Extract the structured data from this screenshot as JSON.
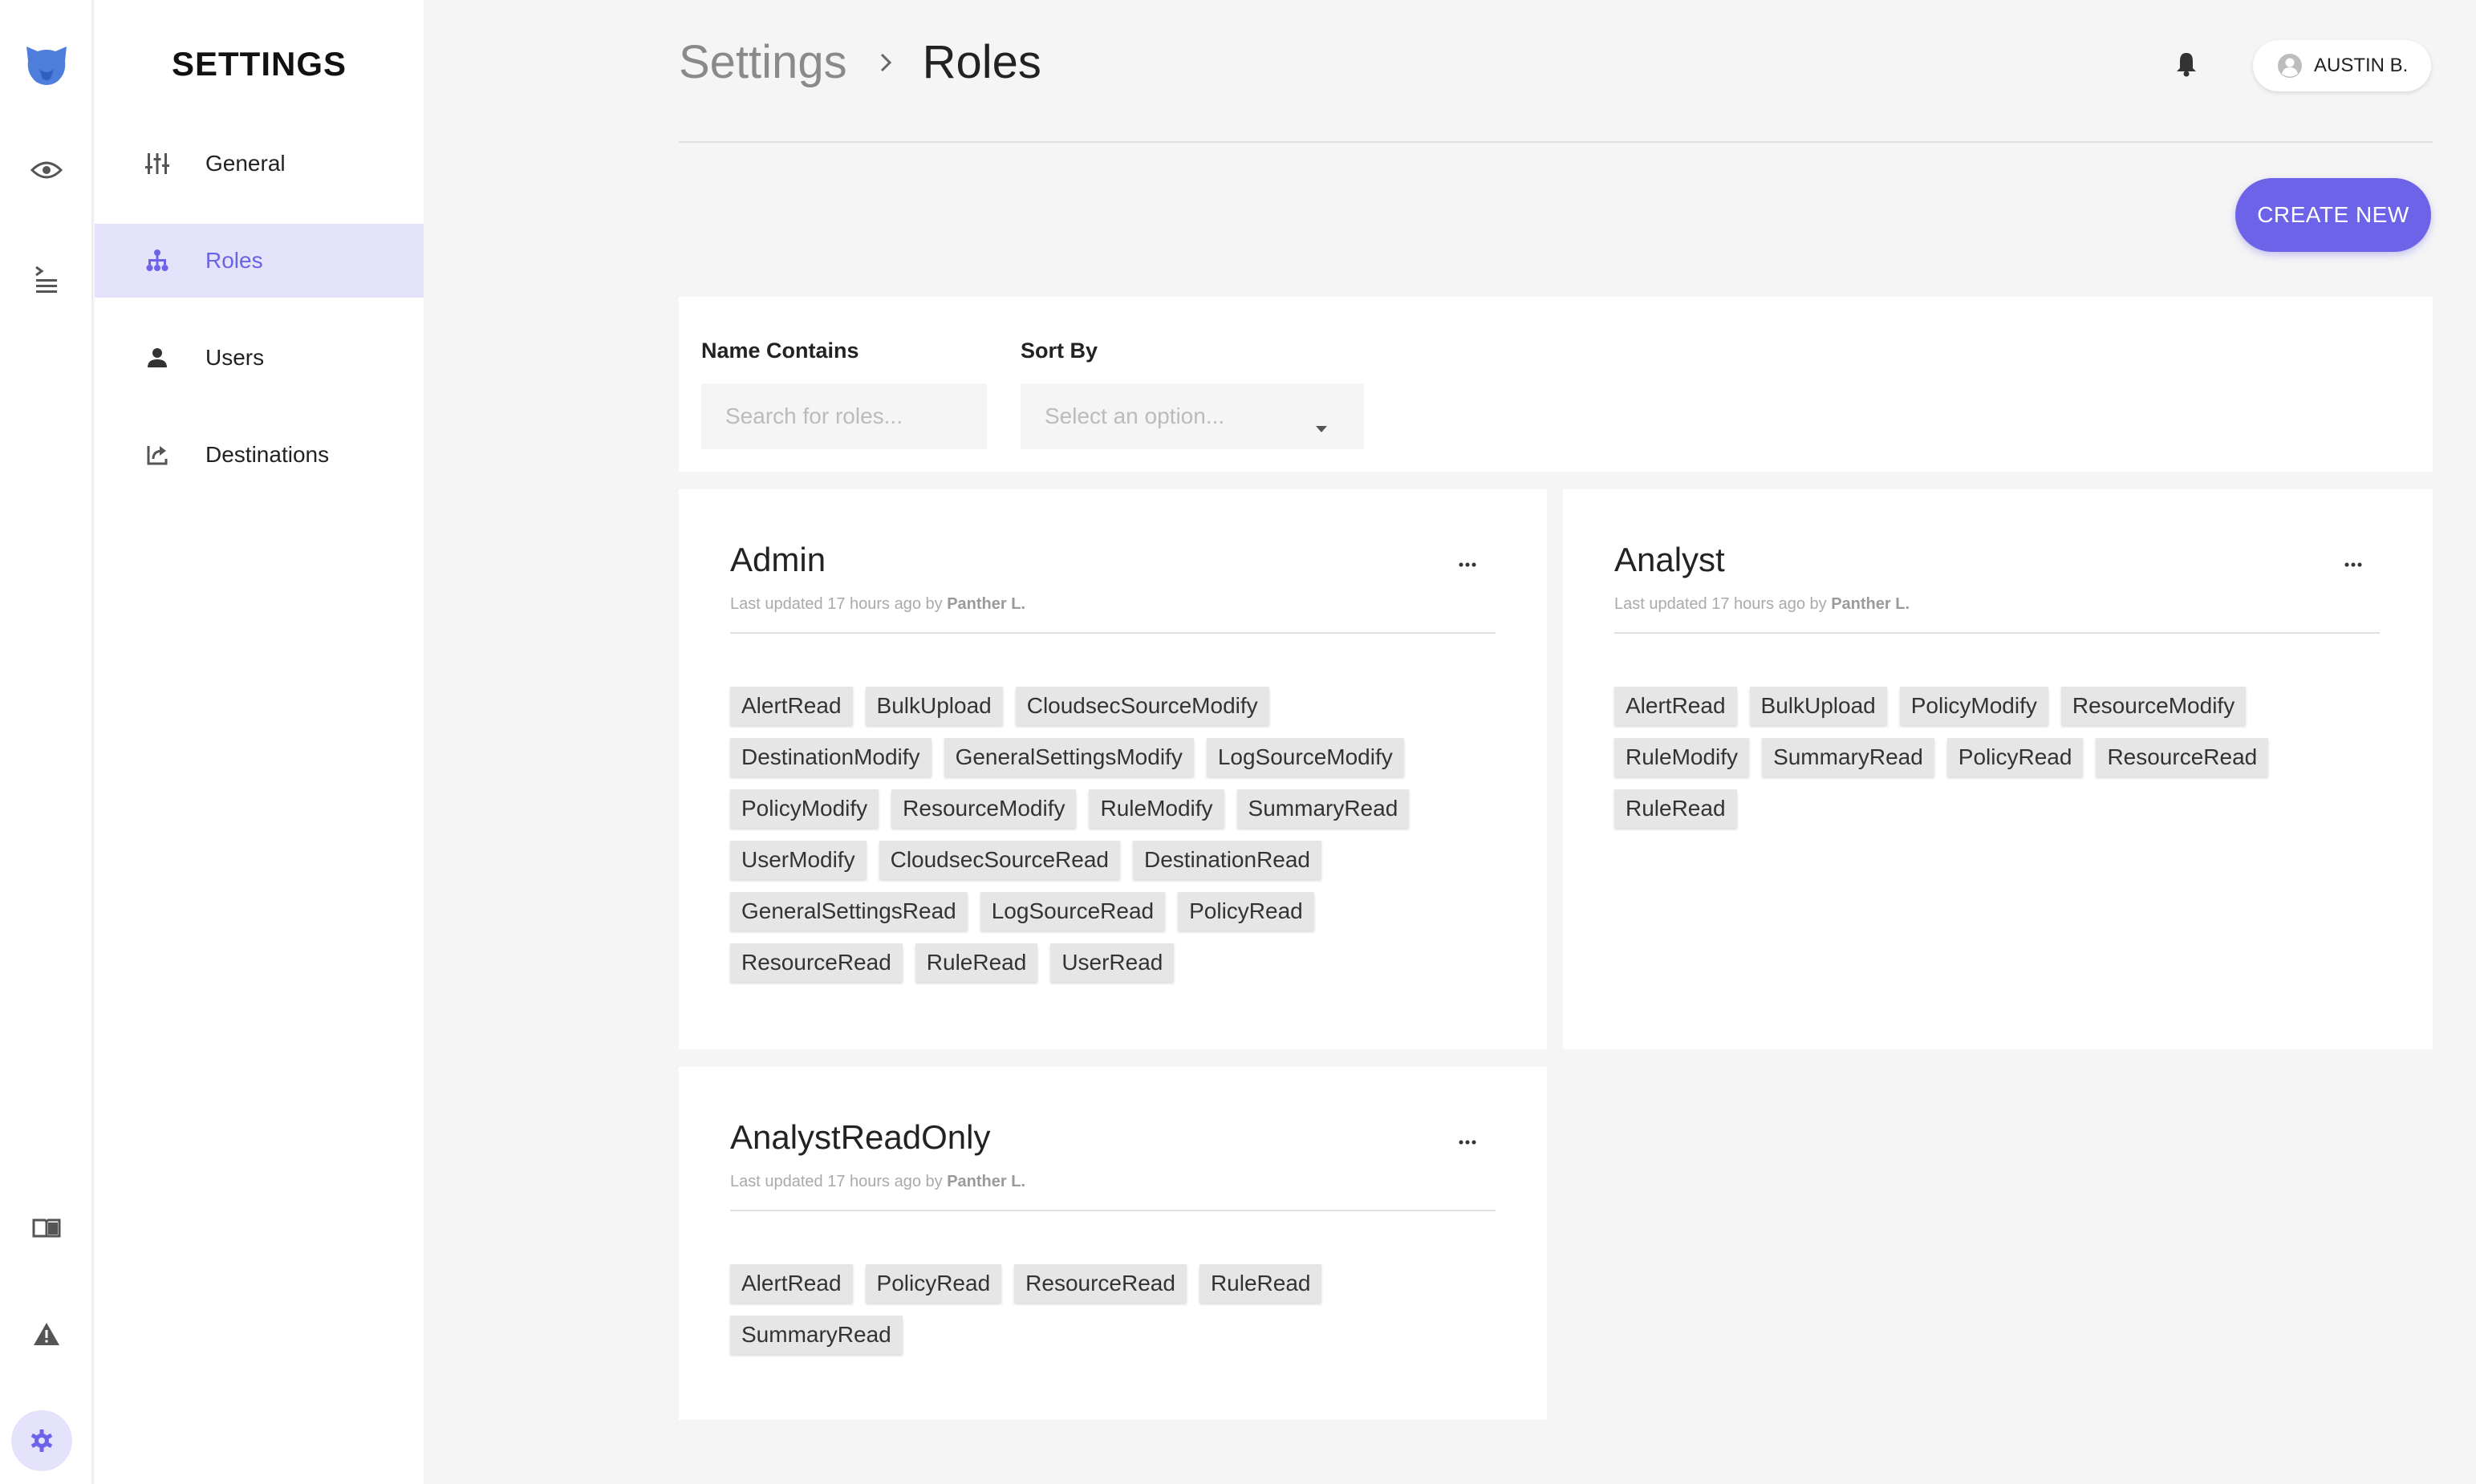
{
  "sidebar": {
    "title": "SETTINGS",
    "items": [
      {
        "label": "General"
      },
      {
        "label": "Roles"
      },
      {
        "label": "Users"
      },
      {
        "label": "Destinations"
      }
    ]
  },
  "header": {
    "breadcrumb_parent": "Settings",
    "breadcrumb_current": "Roles",
    "user_name": "AUSTIN B."
  },
  "actions": {
    "create_label": "CREATE NEW"
  },
  "filters": {
    "name_label": "Name Contains",
    "name_placeholder": "Search for roles...",
    "sort_label": "Sort By",
    "sort_placeholder": "Select an option..."
  },
  "roles": [
    {
      "name": "Admin",
      "meta_prefix": "Last updated 17 hours ago by",
      "meta_author": "Panther L.",
      "permissions": [
        "AlertRead",
        "BulkUpload",
        "CloudsecSourceModify",
        "DestinationModify",
        "GeneralSettingsModify",
        "LogSourceModify",
        "PolicyModify",
        "ResourceModify",
        "RuleModify",
        "SummaryRead",
        "UserModify",
        "CloudsecSourceRead",
        "DestinationRead",
        "GeneralSettingsRead",
        "LogSourceRead",
        "PolicyRead",
        "ResourceRead",
        "RuleRead",
        "UserRead"
      ]
    },
    {
      "name": "Analyst",
      "meta_prefix": "Last updated 17 hours ago by",
      "meta_author": "Panther L.",
      "permissions": [
        "AlertRead",
        "BulkUpload",
        "PolicyModify",
        "ResourceModify",
        "RuleModify",
        "SummaryRead",
        "PolicyRead",
        "ResourceRead",
        "RuleRead"
      ]
    },
    {
      "name": "AnalystReadOnly",
      "meta_prefix": "Last updated 17 hours ago by",
      "meta_author": "Panther L.",
      "permissions": [
        "AlertRead",
        "PolicyRead",
        "ResourceRead",
        "RuleRead",
        "SummaryRead"
      ]
    }
  ],
  "theme": {
    "accent": "#6c63e8",
    "active_bg": "#e4e3fb",
    "brand": "#4f7ddb"
  }
}
